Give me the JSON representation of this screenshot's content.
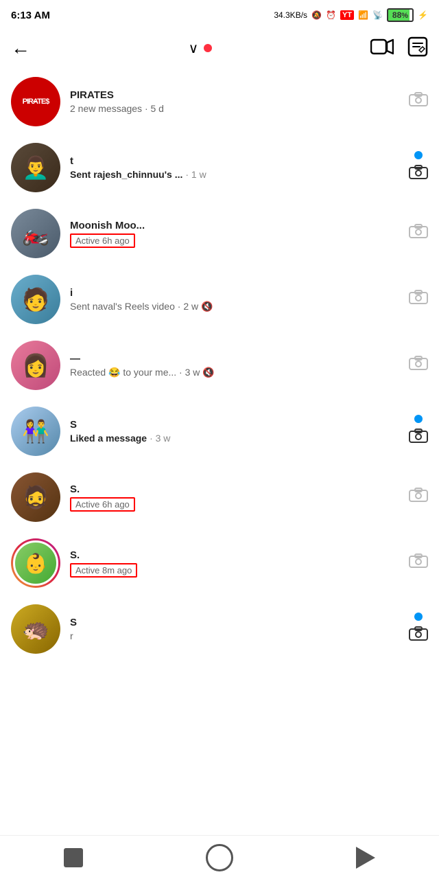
{
  "statusBar": {
    "time": "6:13 AM",
    "network": "34.3KB/s",
    "battery": "88"
  },
  "topNav": {
    "backLabel": "←",
    "dropdownArrow": "∨",
    "videoCallLabel": "Video",
    "editLabel": "Edit"
  },
  "chats": [
    {
      "id": 1,
      "name": "PIRATES",
      "avatarType": "pirates",
      "preview": "2 new messages · 5 d",
      "previewBold": false,
      "hasUnread": false,
      "hasCameraActive": false,
      "showActive": false,
      "activeText": ""
    },
    {
      "id": 2,
      "name": "t",
      "avatarType": "beard",
      "preview": "Sent rajesh_chinnuu's ... · 1 w",
      "previewBold": true,
      "hasUnread": true,
      "hasCameraActive": true,
      "showActive": false,
      "activeText": ""
    },
    {
      "id": 3,
      "name": "Moonish Moo...",
      "avatarType": "moto",
      "preview": "",
      "previewBold": false,
      "hasUnread": false,
      "hasCameraActive": false,
      "showActive": true,
      "activeText": "Active 6h ago"
    },
    {
      "id": 4,
      "name": "i",
      "avatarType": "guy1",
      "preview": "Sent naval's Reels video · 2 w 🔇",
      "previewBold": false,
      "hasUnread": false,
      "hasCameraActive": false,
      "showActive": false,
      "activeText": ""
    },
    {
      "id": 5,
      "name": "—",
      "avatarType": "girl1",
      "preview": "Reacted 😂 to your me... · 3 w 🔇",
      "previewBold": false,
      "hasUnread": false,
      "hasCameraActive": false,
      "showActive": false,
      "activeText": ""
    },
    {
      "id": 6,
      "name": "S",
      "avatarType": "couple",
      "preview": "Liked a message · 3 w",
      "previewBold": true,
      "hasUnread": true,
      "hasCameraActive": true,
      "showActive": false,
      "activeText": ""
    },
    {
      "id": 7,
      "name": "S.",
      "avatarType": "guy2",
      "preview": "",
      "previewBold": false,
      "hasUnread": false,
      "hasCameraActive": false,
      "showActive": true,
      "activeText": "Active 6h ago"
    },
    {
      "id": 8,
      "name": "S.",
      "avatarType": "story",
      "preview": "",
      "previewBold": false,
      "hasUnread": false,
      "hasCameraActive": false,
      "showActive": true,
      "activeText": "Active 8m ago"
    },
    {
      "id": 9,
      "name": "S",
      "avatarType": "yellow",
      "preview": "r",
      "previewBold": false,
      "hasUnread": true,
      "hasCameraActive": true,
      "showActive": false,
      "activeText": ""
    }
  ],
  "bottomNav": {
    "square": "■",
    "circle": "○",
    "triangle": "◄"
  }
}
